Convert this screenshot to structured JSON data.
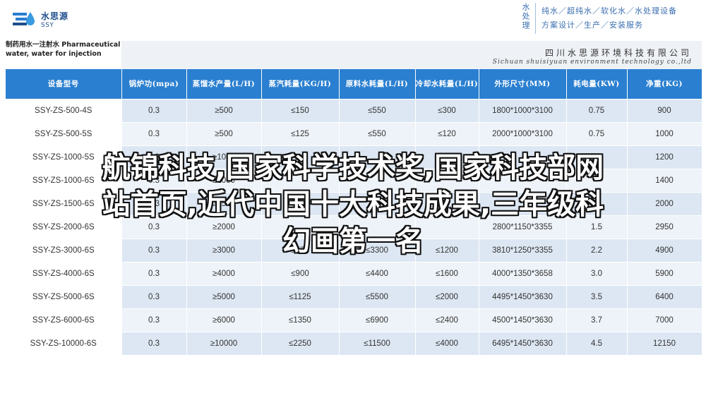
{
  "logo": {
    "name_cn": "水思源",
    "name_en": "SSY"
  },
  "brand": {
    "vertical": "水处理",
    "lines": [
      "纯水／超纯水／软化水／水处理设备",
      "方案设计／生产／安装服务"
    ]
  },
  "product": {
    "title": "制药用水一注射水 Pharmaceutical water, water for injection"
  },
  "company": {
    "name_cn": "四川水思源环境科技有限公司",
    "name_en": "Sichuan shuisiyuan environment technology co.,ltd"
  },
  "table": {
    "headers": [
      "设备型号",
      "锅炉功(mpa)",
      "蒸馏水产量(L/H)",
      "蒸汽耗量(KG/H)",
      "原料水耗量(L/H)",
      "冷却水耗量(L/H)",
      "外形尺寸(MM)",
      "耗电量(KW)",
      "净重(KG)"
    ],
    "rows": [
      [
        "SSY-ZS-500-4S",
        "0.3",
        "≥500",
        "≤150",
        "≤550",
        "≤300",
        "1800*1000*3100",
        "0.75",
        "900"
      ],
      [
        "SSY-ZS-500-5S",
        "0.3",
        "≥500",
        "≤125",
        "≤550",
        "≤120",
        "2000*1000*3100",
        "0.75",
        "1000"
      ],
      [
        "SSY-ZS-1000-5S",
        "0.3",
        "≥1000",
        "",
        "",
        "",
        "",
        "",
        "1200"
      ],
      [
        "SSY-ZS-1000-6S",
        "0.3",
        "≥1000",
        "",
        "",
        "",
        "",
        "",
        "1400"
      ],
      [
        "SSY-ZS-1500-6S",
        "0.3",
        "≥1500",
        "",
        "",
        "",
        "",
        "",
        "2000"
      ],
      [
        "SSY-ZS-2000-6S",
        "0.3",
        "≥2000",
        "",
        "",
        "",
        "2800*1150*3355",
        "1.5",
        "2950"
      ],
      [
        "SSY-ZS-3000-6S",
        "0.3",
        "≥3000",
        "≤675",
        "≤3300",
        "≤1200",
        "3810*1250*3355",
        "2.2",
        "4900"
      ],
      [
        "SSY-ZS-4000-6S",
        "0.3",
        "≥4000",
        "≤900",
        "≤4400",
        "≤1600",
        "4000*1350*3658",
        "3.0",
        "5900"
      ],
      [
        "SSY-ZS-5000-6S",
        "0.3",
        "≥5000",
        "≤1125",
        "≤5500",
        "≤2000",
        "4495*1450*3630",
        "3.5",
        "6400"
      ],
      [
        "SSY-ZS-6000-6S",
        "0.3",
        "≥6000",
        "≤1350",
        "≤6900",
        "≤2400",
        "4500*1450*3630",
        "3.7",
        "7000"
      ],
      [
        "SSY-ZS-10000-6S",
        "0.3",
        "≥10000",
        "≤2250",
        "≤11500",
        "≤4000",
        "6495*1450*3630",
        "4.5",
        "12150"
      ]
    ]
  },
  "overlay": {
    "line1": "航锦科技,国家科学技术奖,国家科技部网",
    "line2": "站首页,近代中国十大科技成果,三年级科",
    "line3": "幻画第一名"
  }
}
